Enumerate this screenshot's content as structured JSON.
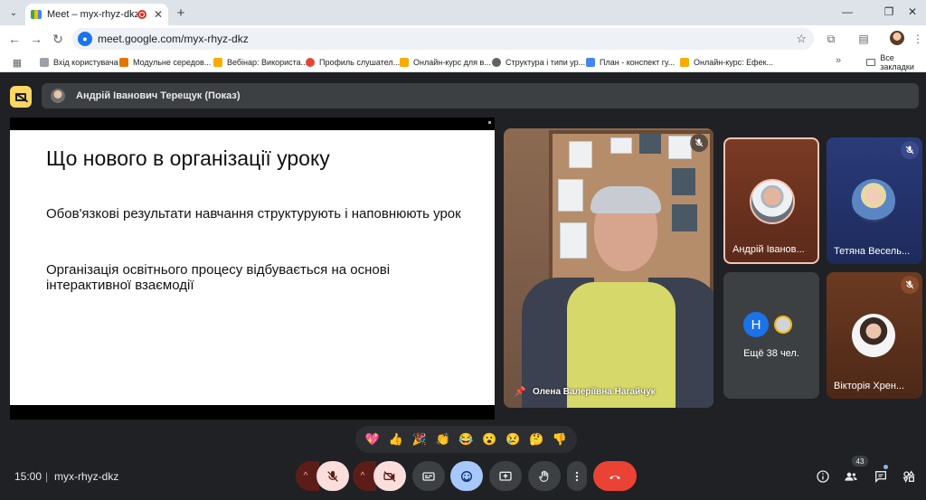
{
  "browser": {
    "tab_title": "Meet – myx-rhyz-dkz",
    "tab_close": "✕",
    "new_tab": "+",
    "url": "meet.google.com/myx-rhyz-dkz",
    "bookmarks": [
      "Вхід користувача",
      "Модульне середов...",
      "Вебінар: Використа...",
      "Профиль слушател...",
      "Онлайн-курс для в...",
      "Структура і типи ур...",
      "План - конспект гу...",
      "Онлайн-курс: Ефек..."
    ],
    "bookmarks_more": "»",
    "all_bookmarks": "Все закладки"
  },
  "meet": {
    "presenter_label": "Андрій Іванович Терещук (Показ)",
    "slide": {
      "heading": "Що нового в організації уроку",
      "paragraph1": "Обов'язкові результати навчання структурують і наповнюють урок",
      "paragraph2": "Організація освітнього процесу відбувається на основі інтерактивної  взаємодії"
    },
    "main_video_name": "Олена Валеріївна Нагайчук",
    "tiles": [
      {
        "name": "Андрій Іванов..."
      },
      {
        "name": "Тетяна Весель..."
      },
      {
        "name": "Ещё 38 чел.",
        "avatar_letter": "H"
      },
      {
        "name": "Вікторія Хрен..."
      }
    ],
    "reactions": [
      "💖",
      "👍",
      "🎉",
      "👏",
      "😂",
      "😮",
      "😢",
      "🤔",
      "👎"
    ],
    "time": "15:00",
    "separator": "|",
    "meeting_code": "myx-rhyz-dkz",
    "participant_count": "43",
    "colors": {
      "end_call": "#ea4335",
      "muted_control": "#f9dedc",
      "accent_blue": "#8ab4f8",
      "present_yellow": "#fdd663"
    }
  }
}
